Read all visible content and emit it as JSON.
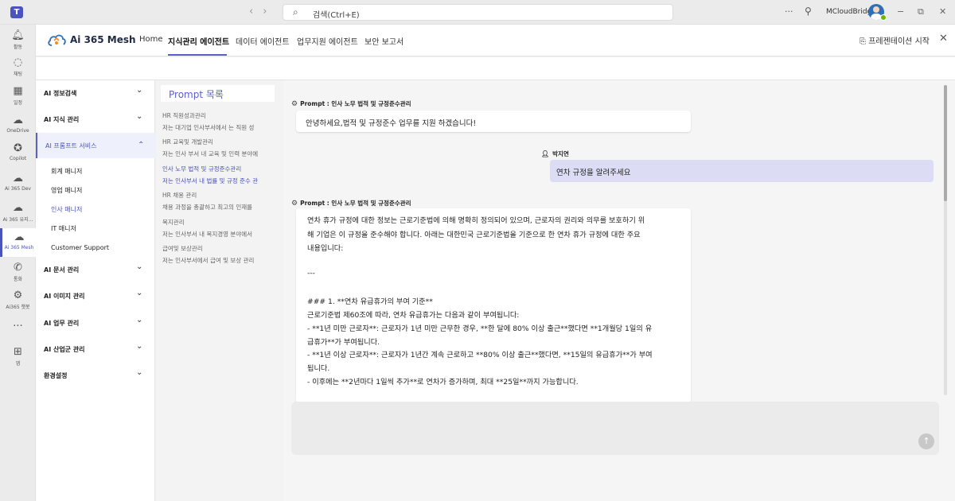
{
  "titlebar": {
    "search_placeholder": "검색(Ctrl+E)",
    "org_name": "MCloudBridge",
    "more_icon": "more-horizontal-icon",
    "minimize": "−",
    "restore": "⧉",
    "close": "✕"
  },
  "rail": {
    "items": [
      {
        "label": "활동",
        "icon": "bell-icon"
      },
      {
        "label": "채팅",
        "icon": "chat-icon"
      },
      {
        "label": "일정",
        "icon": "calendar-icon"
      },
      {
        "label": "OneDrive",
        "icon": "cloud-icon"
      },
      {
        "label": "Copilot",
        "icon": "copilot-icon"
      },
      {
        "label": "Ai 365 Dev",
        "icon": "app-icon"
      },
      {
        "label": "Ai 365 유지...",
        "icon": "app-icon"
      },
      {
        "label": "Ai 365 Mesh",
        "icon": "app-icon"
      },
      {
        "label": "통화",
        "icon": "phone-icon"
      },
      {
        "label": "Ai365 챗봇",
        "icon": "bot-icon"
      },
      {
        "label": "",
        "icon": "more-icon"
      },
      {
        "label": "앱",
        "icon": "add-app-icon"
      }
    ]
  },
  "header": {
    "brand": "Ai 365 Mesh",
    "tabs": [
      "Home",
      "지식관리 에이전트",
      "데이터 에이전트",
      "업무지원 에이전트",
      "보안 보고서"
    ],
    "active_tab": "지식관리 에이전트",
    "present_label": "프레젠테이션 시작"
  },
  "sidebar": {
    "groups": [
      {
        "label": "AI 정보검색",
        "expanded": false
      },
      {
        "label": "AI 지식 관리",
        "expanded": false
      },
      {
        "label": "AI 프롬프트 서비스",
        "expanded": true
      },
      {
        "label": "AI 문서 관리",
        "expanded": false
      },
      {
        "label": "AI 이미지 관리",
        "expanded": false
      },
      {
        "label": "AI 업무 관리",
        "expanded": false
      },
      {
        "label": "AI 산업군 관리",
        "expanded": false
      },
      {
        "label": "환경설정",
        "expanded": false
      }
    ],
    "sub_items": [
      "회계 매니저",
      "영업 매니저",
      "인사 매니저",
      "IT 매니저",
      "Customer Support"
    ],
    "selected_sub": "인사 매니저"
  },
  "prompts": {
    "title": "Prompt 목록",
    "items": [
      {
        "title": "HR 직원성과관리",
        "desc": "저는 대기업 인사부서에서 는 직원 성"
      },
      {
        "title": "HR 교육및 개발관리",
        "desc": "저는 인사 부서 내 교육 및 인력 분야에"
      },
      {
        "title": "인사 노무 법적 및 규정준수관리",
        "desc": "저는 인사부서 내 법률 및 규정 준수 관"
      },
      {
        "title": "HR 채용 관리",
        "desc": "채용 과정을 총괄하고 최고의 인재를"
      },
      {
        "title": "복지관리",
        "desc": "저는 인사부서 내 복지경영 분야에서"
      },
      {
        "title": "급여및 보상관리",
        "desc": "저는 인사부서에서 급여 및 보상 관리"
      }
    ],
    "selected_index": 2
  },
  "chat": {
    "bot_name": "Prompt : 인사 노무 법적 및 규정준수관리",
    "greeting": "안녕하세요,법적 및 규정준수 업무를 지원 하겠습니다!",
    "user_name": "박지연",
    "user_message": "연차 규정을 알려주세요",
    "response_lines": [
      "연차 휴가 규정에 대한 정보는 근로기준법에 의해 명확히 정의되어 있으며, 근로자의 권리와 의무를 보호하기 위",
      "해 기업은 이 규정을 준수해야 합니다. 아래는 대한민국 근로기준법을 기준으로 한 연차 휴가 규정에 대한 주요",
      "내용입니다:",
      "",
      "---",
      "",
      "### 1. **연차 유급휴가의 부여 기준**",
      "근로기준법 제60조에 따라, 연차 유급휴가는 다음과 같이 부여됩니다:",
      "- **1년 미만 근로자**: 근로자가 1년 미만 근무한 경우, **한 달에 80% 이상 출근**했다면 **1개월당 1일의 유",
      "급휴가**가 부여됩니다.",
      "- **1년 이상 근로자**: 근로자가 1년간 계속 근로하고 **80% 이상 출근**했다면, **15일의 유급휴가**가 부여",
      "됩니다.",
      "- 이후에는 **2년마다 1일씩 추가**로 연차가 증가하며, 최대 **25일**까지 가능합니다."
    ]
  }
}
